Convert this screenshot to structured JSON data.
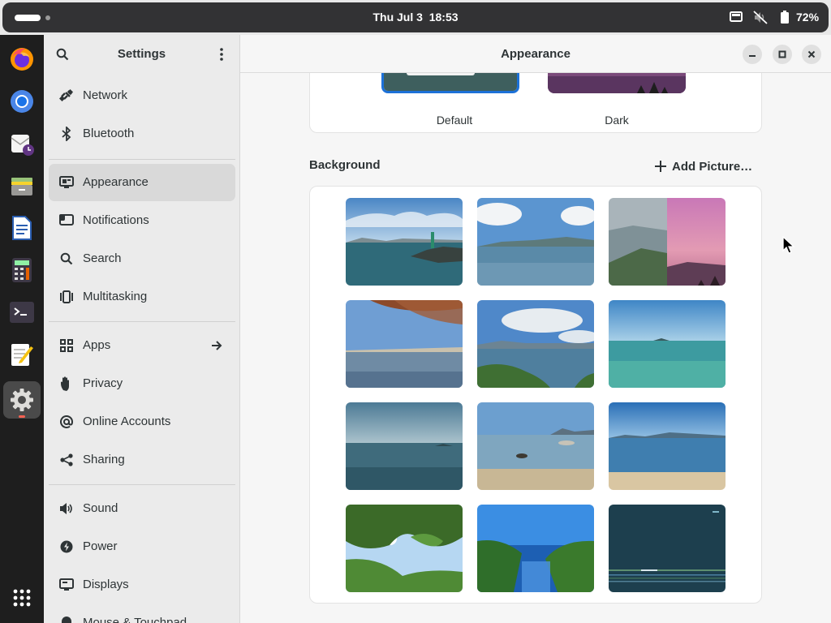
{
  "topbar": {
    "date": "Thu Jul 3",
    "time": "18:53",
    "battery_percent": "72%",
    "tray_icons": [
      "screen-icon",
      "speaker-muted-icon",
      "battery-icon"
    ]
  },
  "dock": {
    "apps": [
      {
        "name": "firefox"
      },
      {
        "name": "chromium"
      },
      {
        "name": "mail-clock"
      },
      {
        "name": "files"
      },
      {
        "name": "text-document"
      },
      {
        "name": "calculator"
      },
      {
        "name": "terminal"
      },
      {
        "name": "text-editor"
      },
      {
        "name": "settings",
        "active": true
      }
    ],
    "show_apps": "app-grid-icon"
  },
  "sidebar": {
    "title": "Settings",
    "items": [
      {
        "label": "Network",
        "icon": "network-icon"
      },
      {
        "label": "Bluetooth",
        "icon": "bluetooth-icon"
      },
      {
        "label": "Appearance",
        "icon": "appearance-icon",
        "selected": true
      },
      {
        "label": "Notifications",
        "icon": "notifications-icon"
      },
      {
        "label": "Search",
        "icon": "search-icon"
      },
      {
        "label": "Multitasking",
        "icon": "multitasking-icon"
      },
      {
        "label": "Apps",
        "icon": "apps-icon"
      },
      {
        "label": "Privacy",
        "icon": "privacy-hand-icon"
      },
      {
        "label": "Online Accounts",
        "icon": "at-icon"
      },
      {
        "label": "Sharing",
        "icon": "share-icon"
      },
      {
        "label": "Sound",
        "icon": "speaker-icon"
      },
      {
        "label": "Power",
        "icon": "power-icon"
      },
      {
        "label": "Displays",
        "icon": "display-icon"
      },
      {
        "label": "Mouse & Touchpad",
        "icon": "mouse-icon"
      }
    ]
  },
  "content": {
    "title": "Appearance",
    "style": {
      "options": [
        {
          "label": "Default",
          "selected": true
        },
        {
          "label": "Dark",
          "selected": false
        }
      ]
    },
    "background": {
      "label": "Background",
      "add_picture_label": "Add Picture…",
      "wallpapers": [
        "wallpaper-1",
        "wallpaper-2",
        "wallpaper-3",
        "wallpaper-4",
        "wallpaper-5",
        "wallpaper-6",
        "wallpaper-7",
        "wallpaper-8",
        "wallpaper-9",
        "wallpaper-10",
        "wallpaper-11",
        "wallpaper-12"
      ]
    }
  },
  "colors": {
    "accent": "#1c71d8",
    "sidebar_bg": "#ebebeb",
    "selected_bg": "#d9d9d9",
    "content_bg": "#f6f6f6"
  }
}
